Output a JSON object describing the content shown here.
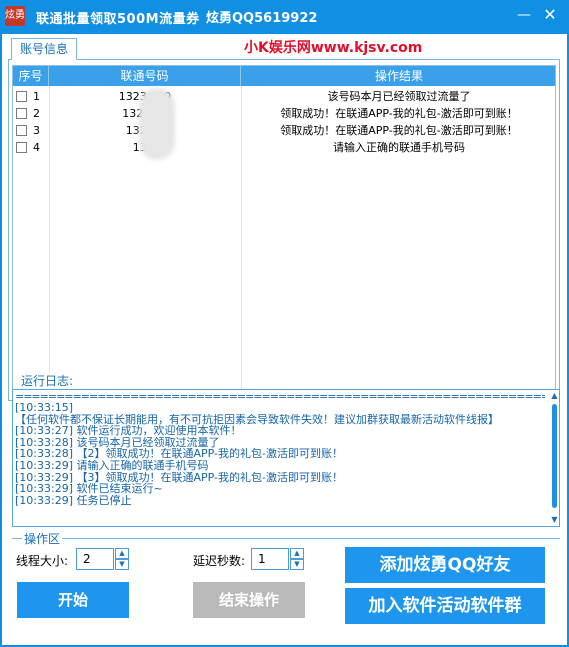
{
  "window": {
    "icon_text": "炫勇",
    "title": "联通批量领取500M流量券",
    "title_qq": "炫勇QQ5619922",
    "minimize_label": "—",
    "close_label": "✕"
  },
  "tab": {
    "label": "账号信息"
  },
  "watermark": "小K娱乐网www.kjsv.com",
  "table": {
    "headers": [
      "序号",
      "联通号码",
      "操作结果"
    ],
    "rows": [
      {
        "no": "1",
        "phone": "1323 619",
        "result": "该号码本月已经领取过流量了"
      },
      {
        "no": "2",
        "phone": "132 778",
        "result": "领取成功！在联通APP-我的礼包-激活即可到账！"
      },
      {
        "no": "3",
        "phone": "132 48",
        "result": "领取成功！在联通APP-我的礼包-激活即可到账！"
      },
      {
        "no": "4",
        "phone": "13 6",
        "result": "请输入正确的联通手机号码"
      }
    ]
  },
  "log": {
    "label": "运行日志:",
    "separator": "========================================================================",
    "lines": [
      "[10:33:15]",
      "【任何软件都不保证长期能用，有不可抗拒因素会导致软件失效！建议加群获取最新活动软件线报】",
      "[10:33:27]  软件运行成功，欢迎使用本软件！",
      "[10:33:28]  该号码本月已经领取过流量了",
      "[10:33:28]  【2】领取成功！在联通APP-我的礼包-激活即可到账！",
      "[10:33:29]  请输入正确的联通手机号码",
      "[10:33:29]  【3】领取成功！在联通APP-我的礼包-激活即可到账！",
      "[10:33:29]  软件已结束运行~",
      "[10:33:29]  任务已停止"
    ]
  },
  "ops": {
    "label": "操作区",
    "threads_label": "线程大小:",
    "threads_value": "2",
    "delay_label": "延迟秒数:",
    "delay_value": "1",
    "start_label": "开始",
    "stop_label": "结束操作",
    "add_friend_label": "添加炫勇QQ好友",
    "join_group_label": "加入软件活动软件群"
  },
  "icons": {
    "spin_up": "▲",
    "spin_down": "▼",
    "scroll_up": "▲",
    "scroll_down": "▼"
  },
  "colors": {
    "titlebar": "#118fe2",
    "accent": "#1e96ee",
    "header": "#3aa0ea",
    "disabled": "#b9b9b9",
    "watermark": "#e0102c"
  }
}
